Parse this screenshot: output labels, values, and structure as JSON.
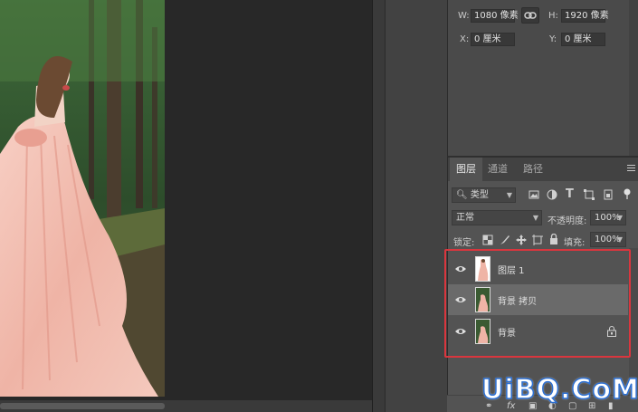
{
  "properties": {
    "w_label": "W:",
    "w_value": "1080 像素",
    "h_label": "H:",
    "h_value": "1920 像素",
    "x_label": "X:",
    "x_value": "0 厘米",
    "y_label": "Y:",
    "y_value": "0 厘米"
  },
  "layers_panel": {
    "tabs": [
      {
        "label": "图层",
        "active": true
      },
      {
        "label": "通道",
        "active": false
      },
      {
        "label": "路径",
        "active": false
      }
    ],
    "filter_kind": "类型",
    "blend_mode": "正常",
    "opacity_label": "不透明度:",
    "opacity_value": "100%",
    "lock_label": "锁定:",
    "fill_label": "填充:",
    "fill_value": "100%",
    "layers": [
      {
        "name": "图层 1",
        "visible": true,
        "selected": false,
        "locked": false,
        "thumbnail": "dress-cutout"
      },
      {
        "name": "背景 拷贝",
        "visible": true,
        "selected": true,
        "locked": false,
        "thumbnail": "photo"
      },
      {
        "name": "背景",
        "visible": true,
        "selected": false,
        "locked": true,
        "thumbnail": "photo"
      }
    ],
    "bottom_icons": [
      "link-icon",
      "fx-icon",
      "mask-icon",
      "adjustment-icon",
      "group-icon",
      "new-layer-icon",
      "trash-icon"
    ]
  },
  "watermark": "UiBQ.CoM",
  "colors": {
    "highlight": "#d9363e",
    "watermark_stroke": "#2d6fd1"
  }
}
